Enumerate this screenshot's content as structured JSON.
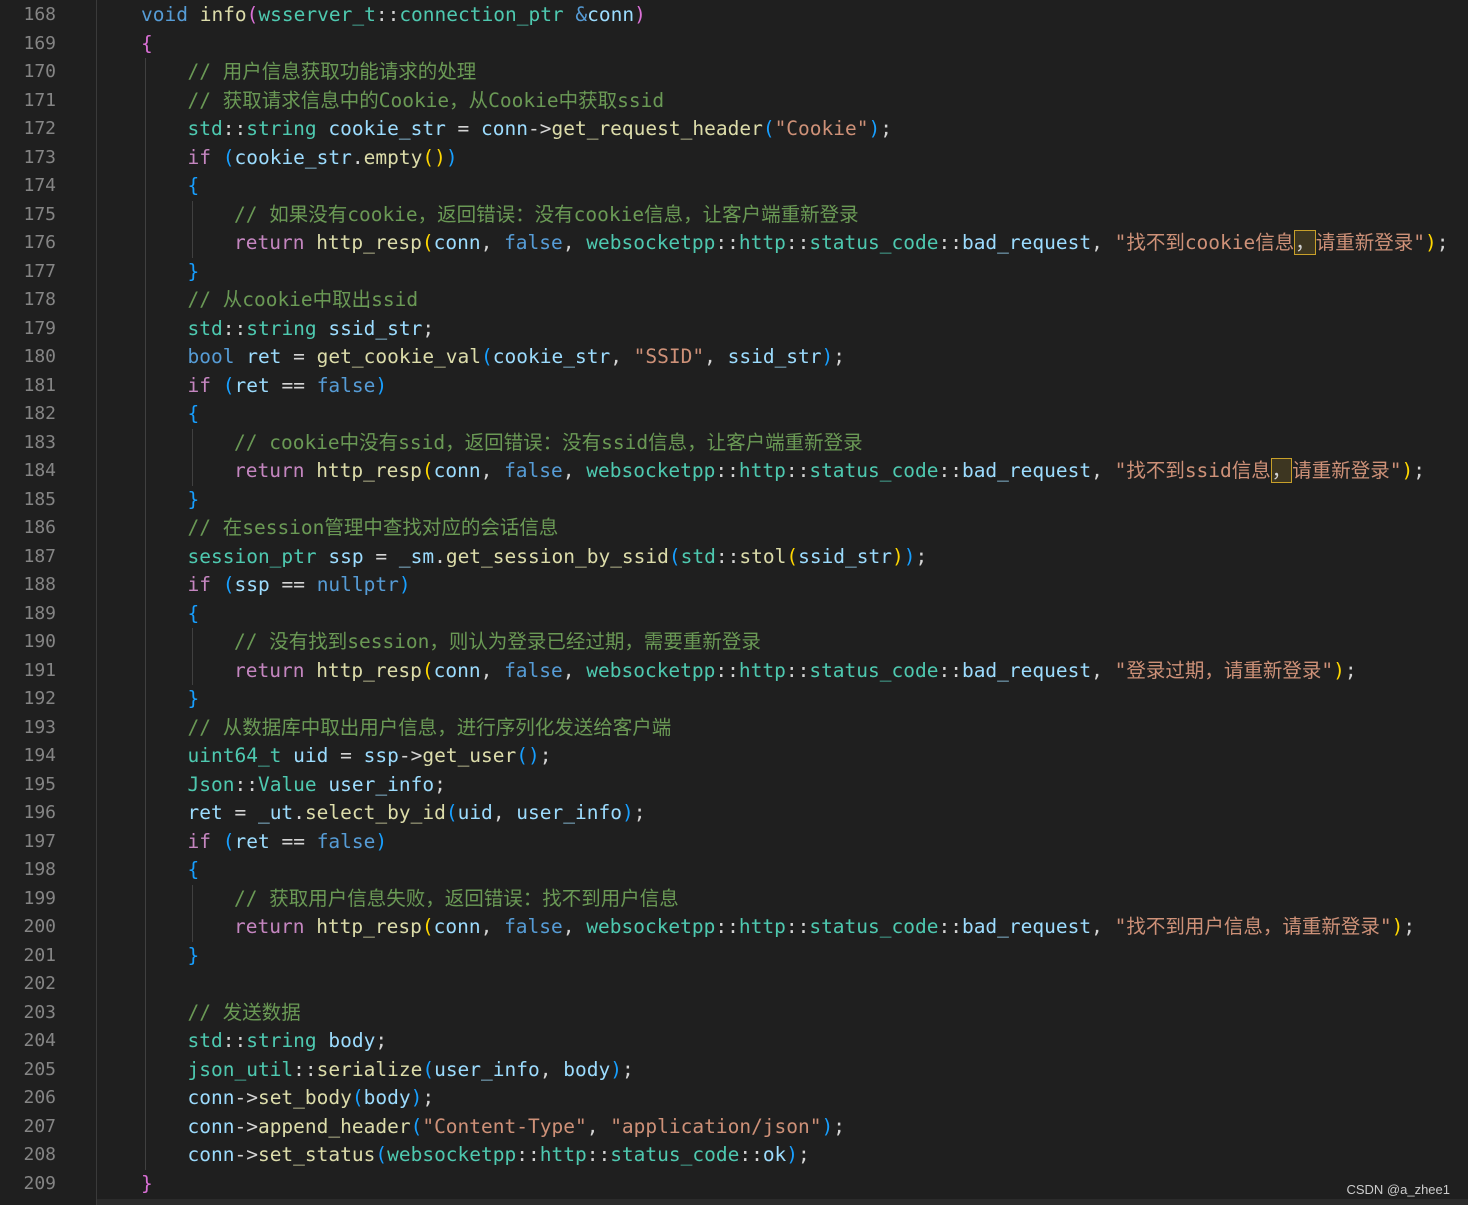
{
  "colors": {
    "background": "#1f1f1f",
    "line_number": "#858585",
    "keyword": "#569cd6",
    "control": "#c586c0",
    "function": "#dcdcaa",
    "variable": "#9cdcfe",
    "type": "#4ec9b0",
    "string": "#ce9178",
    "comment": "#6a9955",
    "bracket_gold": "#ffd700",
    "bracket_purple": "#da70d6",
    "bracket_blue": "#179fff"
  },
  "watermark": "CSDN @a_zhee1",
  "lines": [
    {
      "n": "168",
      "ind": 1,
      "t": [
        [
          "kw",
          "void "
        ],
        [
          "fn",
          "info"
        ],
        [
          "br2",
          "("
        ],
        [
          "ty",
          "wsserver_t"
        ],
        [
          "pun",
          "::"
        ],
        [
          "ty",
          "connection_ptr "
        ],
        [
          "kw",
          "&"
        ],
        [
          "var",
          "conn"
        ],
        [
          "br2",
          ")"
        ]
      ]
    },
    {
      "n": "169",
      "ind": 1,
      "t": [
        [
          "br2",
          "{"
        ]
      ]
    },
    {
      "n": "170",
      "ind": 2,
      "t": [
        [
          "cm",
          "// 用户信息获取功能请求的处理"
        ]
      ]
    },
    {
      "n": "171",
      "ind": 2,
      "t": [
        [
          "cm",
          "// 获取请求信息中的Cookie，从Cookie中获取ssid"
        ]
      ]
    },
    {
      "n": "172",
      "ind": 2,
      "t": [
        [
          "ty",
          "std"
        ],
        [
          "pun",
          "::"
        ],
        [
          "ty",
          "string "
        ],
        [
          "var",
          "cookie_str "
        ],
        [
          "pun",
          "= "
        ],
        [
          "var",
          "conn"
        ],
        [
          "pun",
          "->"
        ],
        [
          "fn",
          "get_request_header"
        ],
        [
          "br3",
          "("
        ],
        [
          "str",
          "\"Cookie\""
        ],
        [
          "br3",
          ")"
        ],
        [
          "pun",
          ";"
        ]
      ]
    },
    {
      "n": "173",
      "ind": 2,
      "t": [
        [
          "ctl",
          "if "
        ],
        [
          "br3",
          "("
        ],
        [
          "var",
          "cookie_str"
        ],
        [
          "pun",
          "."
        ],
        [
          "fn",
          "empty"
        ],
        [
          "br1",
          "()"
        ],
        [
          "br3",
          ")"
        ]
      ]
    },
    {
      "n": "174",
      "ind": 2,
      "t": [
        [
          "br3",
          "{"
        ]
      ]
    },
    {
      "n": "175",
      "ind": 3,
      "t": [
        [
          "cm",
          "// 如果没有cookie，返回错误：没有cookie信息，让客户端重新登录"
        ]
      ]
    },
    {
      "n": "176",
      "ind": 3,
      "t": [
        [
          "ctl",
          "return "
        ],
        [
          "fn",
          "http_resp"
        ],
        [
          "br1",
          "("
        ],
        [
          "var",
          "conn"
        ],
        [
          "pun",
          ", "
        ],
        [
          "kw",
          "false"
        ],
        [
          "pun",
          ", "
        ],
        [
          "ty",
          "websocketpp"
        ],
        [
          "pun",
          "::"
        ],
        [
          "ty",
          "http"
        ],
        [
          "pun",
          "::"
        ],
        [
          "ty",
          "status_code"
        ],
        [
          "pun",
          "::"
        ],
        [
          "var",
          "bad_request"
        ],
        [
          "pun",
          ", "
        ],
        [
          "str",
          "\"找不到cookie信息"
        ],
        [
          "hl",
          "，"
        ],
        [
          "str",
          "请重新登录\""
        ],
        [
          "br1",
          ")"
        ],
        [
          "pun",
          ";"
        ]
      ]
    },
    {
      "n": "177",
      "ind": 2,
      "t": [
        [
          "br3",
          "}"
        ]
      ]
    },
    {
      "n": "178",
      "ind": 2,
      "t": [
        [
          "cm",
          "// 从cookie中取出ssid"
        ]
      ]
    },
    {
      "n": "179",
      "ind": 2,
      "t": [
        [
          "ty",
          "std"
        ],
        [
          "pun",
          "::"
        ],
        [
          "ty",
          "string "
        ],
        [
          "var",
          "ssid_str"
        ],
        [
          "pun",
          ";"
        ]
      ]
    },
    {
      "n": "180",
      "ind": 2,
      "t": [
        [
          "kw",
          "bool "
        ],
        [
          "var",
          "ret "
        ],
        [
          "pun",
          "= "
        ],
        [
          "fn",
          "get_cookie_val"
        ],
        [
          "br3",
          "("
        ],
        [
          "var",
          "cookie_str"
        ],
        [
          "pun",
          ", "
        ],
        [
          "str",
          "\"SSID\""
        ],
        [
          "pun",
          ", "
        ],
        [
          "var",
          "ssid_str"
        ],
        [
          "br3",
          ")"
        ],
        [
          "pun",
          ";"
        ]
      ]
    },
    {
      "n": "181",
      "ind": 2,
      "t": [
        [
          "ctl",
          "if "
        ],
        [
          "br3",
          "("
        ],
        [
          "var",
          "ret "
        ],
        [
          "pun",
          "== "
        ],
        [
          "kw",
          "false"
        ],
        [
          "br3",
          ")"
        ]
      ]
    },
    {
      "n": "182",
      "ind": 2,
      "t": [
        [
          "br3",
          "{"
        ]
      ]
    },
    {
      "n": "183",
      "ind": 3,
      "t": [
        [
          "cm",
          "// cookie中没有ssid，返回错误：没有ssid信息，让客户端重新登录"
        ]
      ]
    },
    {
      "n": "184",
      "ind": 3,
      "t": [
        [
          "ctl",
          "return "
        ],
        [
          "fn",
          "http_resp"
        ],
        [
          "br1",
          "("
        ],
        [
          "var",
          "conn"
        ],
        [
          "pun",
          ", "
        ],
        [
          "kw",
          "false"
        ],
        [
          "pun",
          ", "
        ],
        [
          "ty",
          "websocketpp"
        ],
        [
          "pun",
          "::"
        ],
        [
          "ty",
          "http"
        ],
        [
          "pun",
          "::"
        ],
        [
          "ty",
          "status_code"
        ],
        [
          "pun",
          "::"
        ],
        [
          "var",
          "bad_request"
        ],
        [
          "pun",
          ", "
        ],
        [
          "str",
          "\"找不到ssid信息"
        ],
        [
          "hl",
          "，"
        ],
        [
          "str",
          "请重新登录\""
        ],
        [
          "br1",
          ")"
        ],
        [
          "pun",
          ";"
        ]
      ]
    },
    {
      "n": "185",
      "ind": 2,
      "t": [
        [
          "br3",
          "}"
        ]
      ]
    },
    {
      "n": "186",
      "ind": 2,
      "t": [
        [
          "cm",
          "// 在session管理中查找对应的会话信息"
        ]
      ]
    },
    {
      "n": "187",
      "ind": 2,
      "t": [
        [
          "ty",
          "session_ptr "
        ],
        [
          "var",
          "ssp "
        ],
        [
          "pun",
          "= "
        ],
        [
          "var",
          "_sm"
        ],
        [
          "pun",
          "."
        ],
        [
          "fn",
          "get_session_by_ssid"
        ],
        [
          "br3",
          "("
        ],
        [
          "ty",
          "std"
        ],
        [
          "pun",
          "::"
        ],
        [
          "fn",
          "stol"
        ],
        [
          "br1",
          "("
        ],
        [
          "var",
          "ssid_str"
        ],
        [
          "br1",
          ")"
        ],
        [
          "br3",
          ")"
        ],
        [
          "pun",
          ";"
        ]
      ]
    },
    {
      "n": "188",
      "ind": 2,
      "t": [
        [
          "ctl",
          "if "
        ],
        [
          "br3",
          "("
        ],
        [
          "var",
          "ssp "
        ],
        [
          "pun",
          "== "
        ],
        [
          "kw",
          "nullptr"
        ],
        [
          "br3",
          ")"
        ]
      ]
    },
    {
      "n": "189",
      "ind": 2,
      "t": [
        [
          "br3",
          "{"
        ]
      ]
    },
    {
      "n": "190",
      "ind": 3,
      "t": [
        [
          "cm",
          "// 没有找到session，则认为登录已经过期，需要重新登录"
        ]
      ]
    },
    {
      "n": "191",
      "ind": 3,
      "t": [
        [
          "ctl",
          "return "
        ],
        [
          "fn",
          "http_resp"
        ],
        [
          "br1",
          "("
        ],
        [
          "var",
          "conn"
        ],
        [
          "pun",
          ", "
        ],
        [
          "kw",
          "false"
        ],
        [
          "pun",
          ", "
        ],
        [
          "ty",
          "websocketpp"
        ],
        [
          "pun",
          "::"
        ],
        [
          "ty",
          "http"
        ],
        [
          "pun",
          "::"
        ],
        [
          "ty",
          "status_code"
        ],
        [
          "pun",
          "::"
        ],
        [
          "var",
          "bad_request"
        ],
        [
          "pun",
          ", "
        ],
        [
          "str",
          "\"登录过期，请重新登录\""
        ],
        [
          "br1",
          ")"
        ],
        [
          "pun",
          ";"
        ]
      ]
    },
    {
      "n": "192",
      "ind": 2,
      "t": [
        [
          "br3",
          "}"
        ]
      ]
    },
    {
      "n": "193",
      "ind": 2,
      "t": [
        [
          "cm",
          "// 从数据库中取出用户信息，进行序列化发送给客户端"
        ]
      ]
    },
    {
      "n": "194",
      "ind": 2,
      "t": [
        [
          "ty",
          "uint64_t "
        ],
        [
          "var",
          "uid "
        ],
        [
          "pun",
          "= "
        ],
        [
          "var",
          "ssp"
        ],
        [
          "pun",
          "->"
        ],
        [
          "fn",
          "get_user"
        ],
        [
          "br3",
          "()"
        ],
        [
          "pun",
          ";"
        ]
      ]
    },
    {
      "n": "195",
      "ind": 2,
      "t": [
        [
          "ty",
          "Json"
        ],
        [
          "pun",
          "::"
        ],
        [
          "ty",
          "Value "
        ],
        [
          "var",
          "user_info"
        ],
        [
          "pun",
          ";"
        ]
      ]
    },
    {
      "n": "196",
      "ind": 2,
      "t": [
        [
          "var",
          "ret "
        ],
        [
          "pun",
          "= "
        ],
        [
          "var",
          "_ut"
        ],
        [
          "pun",
          "."
        ],
        [
          "fn",
          "select_by_id"
        ],
        [
          "br3",
          "("
        ],
        [
          "var",
          "uid"
        ],
        [
          "pun",
          ", "
        ],
        [
          "var",
          "user_info"
        ],
        [
          "br3",
          ")"
        ],
        [
          "pun",
          ";"
        ]
      ]
    },
    {
      "n": "197",
      "ind": 2,
      "t": [
        [
          "ctl",
          "if "
        ],
        [
          "br3",
          "("
        ],
        [
          "var",
          "ret "
        ],
        [
          "pun",
          "== "
        ],
        [
          "kw",
          "false"
        ],
        [
          "br3",
          ")"
        ]
      ]
    },
    {
      "n": "198",
      "ind": 2,
      "t": [
        [
          "br3",
          "{"
        ]
      ]
    },
    {
      "n": "199",
      "ind": 3,
      "t": [
        [
          "cm",
          "// 获取用户信息失败，返回错误：找不到用户信息"
        ]
      ]
    },
    {
      "n": "200",
      "ind": 3,
      "t": [
        [
          "ctl",
          "return "
        ],
        [
          "fn",
          "http_resp"
        ],
        [
          "br1",
          "("
        ],
        [
          "var",
          "conn"
        ],
        [
          "pun",
          ", "
        ],
        [
          "kw",
          "false"
        ],
        [
          "pun",
          ", "
        ],
        [
          "ty",
          "websocketpp"
        ],
        [
          "pun",
          "::"
        ],
        [
          "ty",
          "http"
        ],
        [
          "pun",
          "::"
        ],
        [
          "ty",
          "status_code"
        ],
        [
          "pun",
          "::"
        ],
        [
          "var",
          "bad_request"
        ],
        [
          "pun",
          ", "
        ],
        [
          "str",
          "\"找不到用户信息，请重新登录\""
        ],
        [
          "br1",
          ")"
        ],
        [
          "pun",
          ";"
        ]
      ]
    },
    {
      "n": "201",
      "ind": 2,
      "t": [
        [
          "br3",
          "}"
        ]
      ]
    },
    {
      "n": "202",
      "ind": 2,
      "t": []
    },
    {
      "n": "203",
      "ind": 2,
      "t": [
        [
          "cm",
          "// 发送数据"
        ]
      ]
    },
    {
      "n": "204",
      "ind": 2,
      "t": [
        [
          "ty",
          "std"
        ],
        [
          "pun",
          "::"
        ],
        [
          "ty",
          "string "
        ],
        [
          "var",
          "body"
        ],
        [
          "pun",
          ";"
        ]
      ]
    },
    {
      "n": "205",
      "ind": 2,
      "t": [
        [
          "ty",
          "json_util"
        ],
        [
          "pun",
          "::"
        ],
        [
          "fn",
          "serialize"
        ],
        [
          "br3",
          "("
        ],
        [
          "var",
          "user_info"
        ],
        [
          "pun",
          ", "
        ],
        [
          "var",
          "body"
        ],
        [
          "br3",
          ")"
        ],
        [
          "pun",
          ";"
        ]
      ]
    },
    {
      "n": "206",
      "ind": 2,
      "t": [
        [
          "var",
          "conn"
        ],
        [
          "pun",
          "->"
        ],
        [
          "fn",
          "set_body"
        ],
        [
          "br3",
          "("
        ],
        [
          "var",
          "body"
        ],
        [
          "br3",
          ")"
        ],
        [
          "pun",
          ";"
        ]
      ]
    },
    {
      "n": "207",
      "ind": 2,
      "t": [
        [
          "var",
          "conn"
        ],
        [
          "pun",
          "->"
        ],
        [
          "fn",
          "append_header"
        ],
        [
          "br3",
          "("
        ],
        [
          "str",
          "\"Content-Type\""
        ],
        [
          "pun",
          ", "
        ],
        [
          "str",
          "\"application/json\""
        ],
        [
          "br3",
          ")"
        ],
        [
          "pun",
          ";"
        ]
      ]
    },
    {
      "n": "208",
      "ind": 2,
      "t": [
        [
          "var",
          "conn"
        ],
        [
          "pun",
          "->"
        ],
        [
          "fn",
          "set_status"
        ],
        [
          "br3",
          "("
        ],
        [
          "ty",
          "websocketpp"
        ],
        [
          "pun",
          "::"
        ],
        [
          "ty",
          "http"
        ],
        [
          "pun",
          "::"
        ],
        [
          "ty",
          "status_code"
        ],
        [
          "pun",
          "::"
        ],
        [
          "var",
          "ok"
        ],
        [
          "br3",
          ")"
        ],
        [
          "pun",
          ";"
        ]
      ]
    },
    {
      "n": "209",
      "ind": 1,
      "t": [
        [
          "br2",
          "}"
        ]
      ]
    }
  ]
}
